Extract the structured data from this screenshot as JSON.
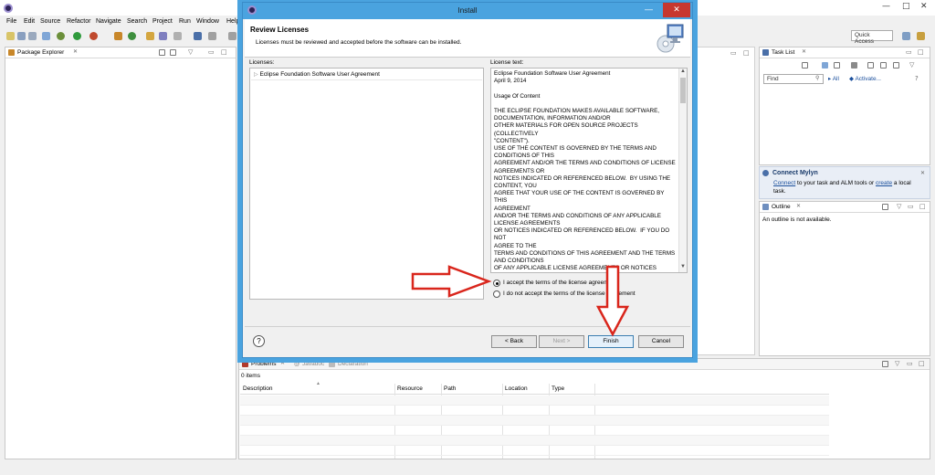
{
  "window": {
    "min": "—",
    "max": "□",
    "close": "✕"
  },
  "menu": [
    "File",
    "Edit",
    "Source",
    "Refactor",
    "Navigate",
    "Search",
    "Project",
    "Run",
    "Window",
    "Help"
  ],
  "toolbar": {
    "quick_access": "Quick Access"
  },
  "package_explorer": {
    "title": "Package Explorer"
  },
  "task_list": {
    "title": "Task List",
    "find_placeholder": "Find",
    "all": "All",
    "activate": "Activate..."
  },
  "mylyn": {
    "title": "Connect Mylyn",
    "connect_link": "Connect",
    "text_mid": " to your task and ALM tools or ",
    "create_link": "create",
    "text_end": " a local",
    "line2": "task."
  },
  "outline": {
    "title": "Outline",
    "message": "An outline is not available."
  },
  "bottom": {
    "tabs": [
      "Problems",
      "Javadoc",
      "Declaration"
    ],
    "count": "0 items",
    "columns": [
      "Description",
      "Resource",
      "Path",
      "Location",
      "Type"
    ]
  },
  "dialog": {
    "title": "Install",
    "close": "✕",
    "min": "—",
    "heading": "Review Licenses",
    "subheading": "Licenses must be reviewed and accepted before the software can be installed.",
    "licenses_label": "Licenses:",
    "license_text_label": "License text:",
    "license_item": "Eclipse Foundation Software User Agreement",
    "license_text": "Eclipse Foundation Software User Agreement\nApril 9, 2014\n\nUsage Of Content\n\nTHE ECLIPSE FOUNDATION MAKES AVAILABLE SOFTWARE,\nDOCUMENTATION, INFORMATION AND/OR\nOTHER MATERIALS FOR OPEN SOURCE PROJECTS (COLLECTIVELY\n\"CONTENT\").\nUSE OF THE CONTENT IS GOVERNED BY THE TERMS AND\nCONDITIONS OF THIS\nAGREEMENT AND/OR THE TERMS AND CONDITIONS OF LICENSE\nAGREEMENTS OR\nNOTICES INDICATED OR REFERENCED BELOW.  BY USING THE\nCONTENT, YOU\nAGREE THAT YOUR USE OF THE CONTENT IS GOVERNED BY THIS\nAGREEMENT\nAND/OR THE TERMS AND CONDITIONS OF ANY APPLICABLE\nLICENSE AGREEMENTS\nOR NOTICES INDICATED OR REFERENCED BELOW.  IF YOU DO NOT\nAGREE TO THE\nTERMS AND CONDITIONS OF THIS AGREEMENT AND THE TERMS\nAND CONDITIONS\nOF ANY APPLICABLE LICENSE AGREEMENTS OR NOTICES\nINDICATED OR REFERENCED\nBELOW, THEN YOU MAY NOT USE THE CONTENT.",
    "accept": "I accept the terms of the license agreement",
    "decline": "I do not accept the terms of the license agreement",
    "accepted": true,
    "help": "?",
    "back": "< Back",
    "next": "Next >",
    "finish": "Finish",
    "cancel": "Cancel"
  },
  "colors": {
    "dialog_frame": "#4aa3df",
    "close_button": "#c7372f",
    "annotation_arrow": "#d9261c",
    "link": "#1a4f9c"
  }
}
